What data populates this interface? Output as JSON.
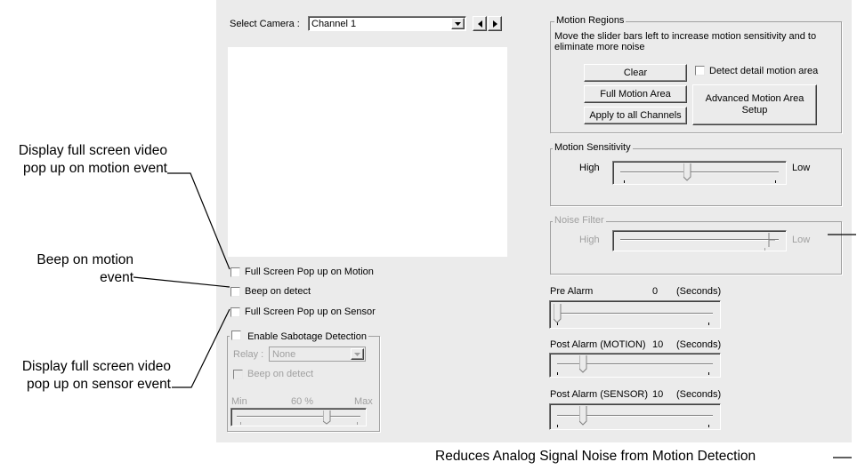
{
  "camera": {
    "label": "Select Camera :",
    "value": "Channel 1"
  },
  "left_checks": [
    {
      "label": "Full Screen Pop up on Motion"
    },
    {
      "label": "Beep on detect"
    },
    {
      "label": "Full Screen Pop up on Sensor"
    }
  ],
  "sabotage": {
    "title": "Enable Sabotage Detection",
    "relay_label": "Relay :",
    "relay_value": "None",
    "beep_label": "Beep on detect",
    "min_label": "Min",
    "value_label": "60 %",
    "max_label": "Max",
    "slider_value_fraction": 0.74
  },
  "motion_regions": {
    "title": "Motion Regions",
    "description": "Move the slider bars left to increase motion sensitivity and to eliminate more noise",
    "clear_button": "Clear",
    "detect_detail_label": "Detect detail motion area",
    "full_area_button": "Full Motion Area",
    "apply_all_button": "Apply to all Channels",
    "advanced_button": "Advanced Motion Area Setup"
  },
  "sensitivity": {
    "title": "Motion Sensitivity",
    "high": "High",
    "low": "Low",
    "value_fraction": 0.42
  },
  "noise": {
    "title": "Noise Filter",
    "high": "High",
    "low": "Low",
    "value_fraction": 0.97
  },
  "pre_alarm": {
    "label": "Pre Alarm",
    "value": "0",
    "unit": "(Seconds)",
    "value_fraction": 0.0
  },
  "post_motion": {
    "label": "Post Alarm (MOTION)",
    "value": "10",
    "unit": "(Seconds)",
    "value_fraction": 0.17
  },
  "post_sensor": {
    "label": "Post Alarm (SENSOR)",
    "value": "10",
    "unit": "(Seconds)",
    "value_fraction": 0.17
  },
  "annotations": {
    "popup_motion": "Display full screen video pop up on motion event",
    "beep": "Beep on motion event",
    "popup_sensor": "Display full screen video pop up on sensor event",
    "noise": "Reduces Analog Signal Noise from Motion Detection"
  }
}
